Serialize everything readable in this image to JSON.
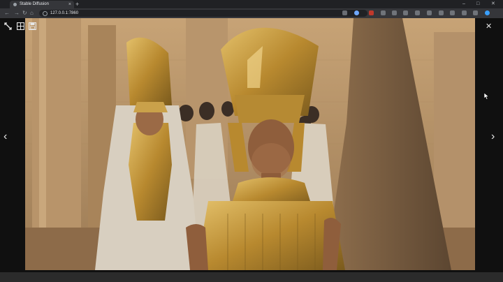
{
  "browser": {
    "tab_title": "Stable Diffusion",
    "url": "127.0.0.1:7860",
    "new_tab_symbol": "+",
    "tab_close_symbol": "×"
  },
  "window_controls": {
    "minimize": "–",
    "maximize": "□",
    "close": "✕"
  },
  "nav_symbols": {
    "back": "←",
    "forward": "→",
    "reload": "↻",
    "home": "⌂"
  },
  "viewer": {
    "close_symbol": "✕",
    "prev_symbol": "‹",
    "next_symbol": "›",
    "icons": [
      "fullscreen-icon",
      "tile-icon",
      "save-icon"
    ]
  },
  "colors": {
    "sandstone": "#c9a579",
    "gold": "#c99a3a",
    "shadow": "#5c4631",
    "chrome": "#35363a"
  }
}
